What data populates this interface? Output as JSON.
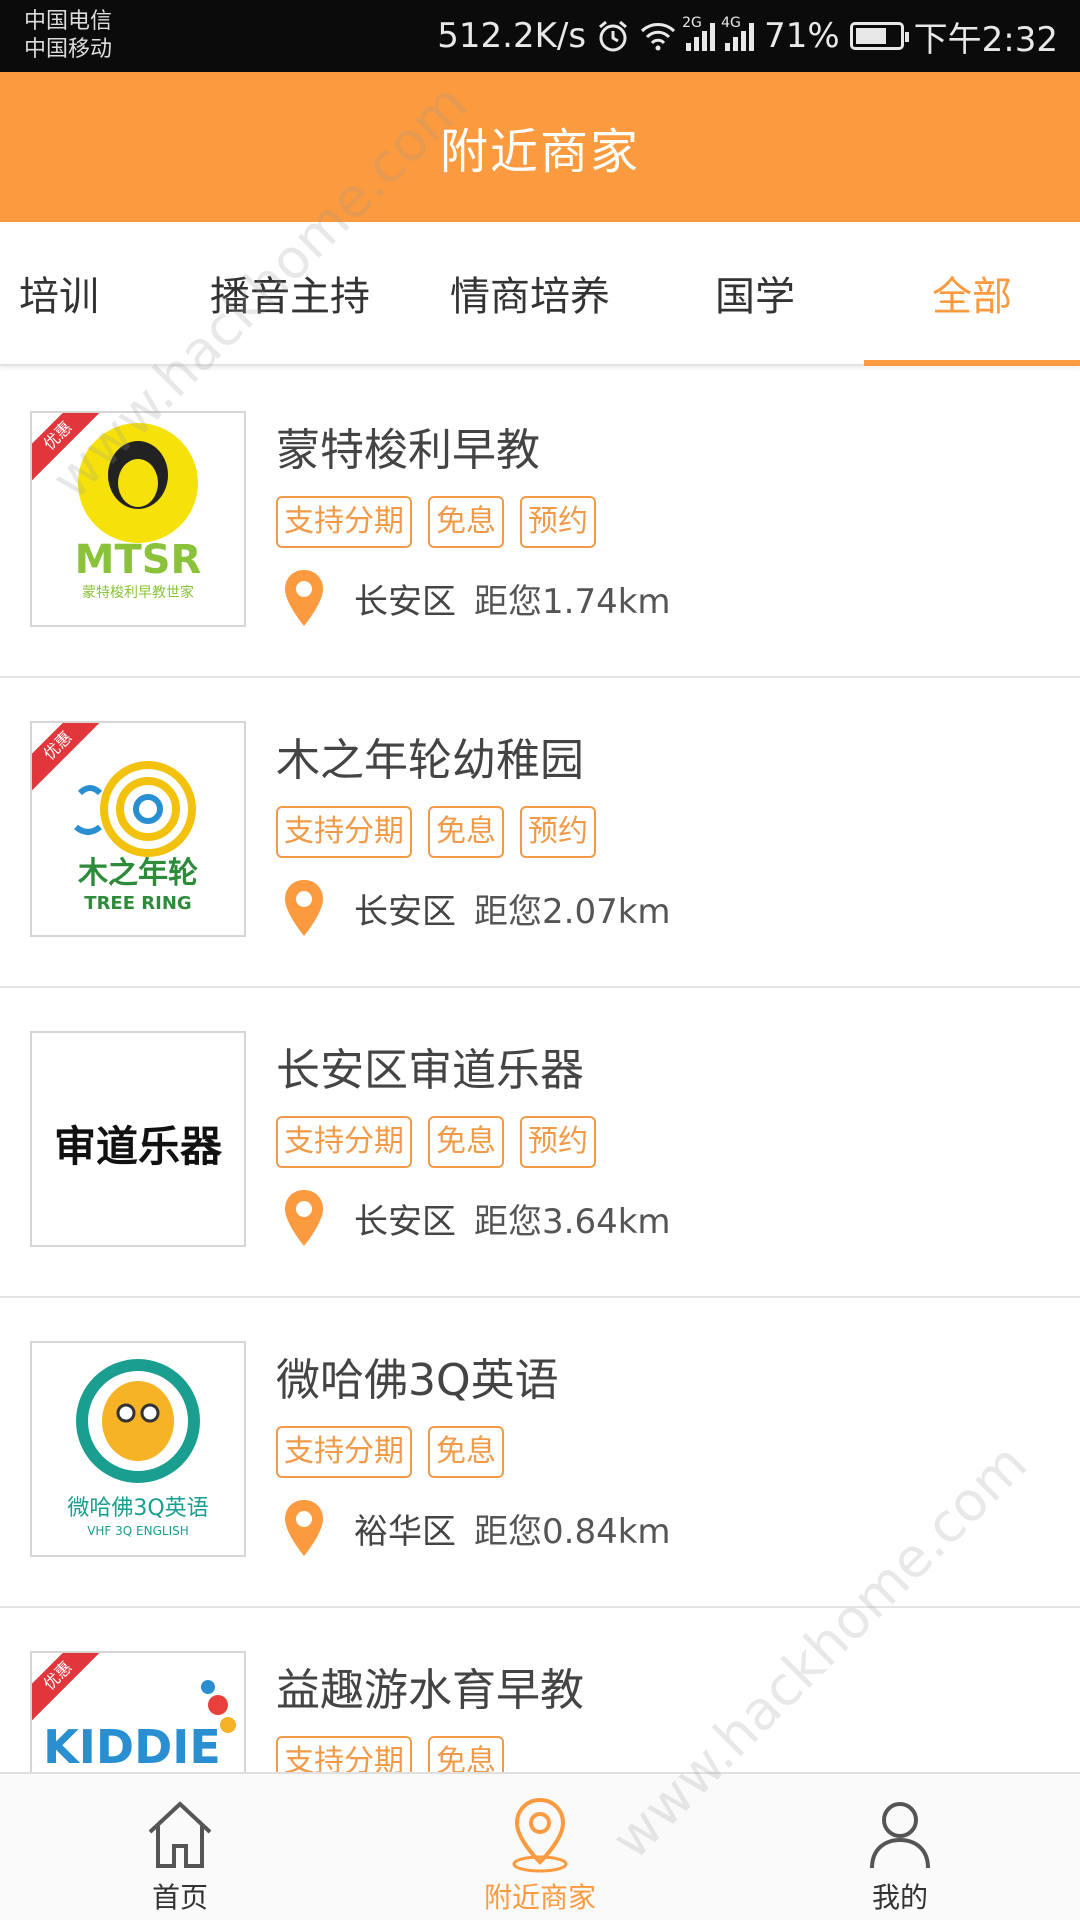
{
  "status_bar": {
    "carrier_1": "中国电信",
    "carrier_2": "中国移动",
    "speed": "512.2K/s",
    "net_2g": "2G",
    "net_4g": "4G",
    "battery": "71%",
    "battery_level": 0.71,
    "time": "下午2:32"
  },
  "header": {
    "title": "附近商家"
  },
  "tabs": [
    {
      "label": "培训",
      "active": false
    },
    {
      "label": "播音主持",
      "active": false
    },
    {
      "label": "情商培养",
      "active": false
    },
    {
      "label": "国学",
      "active": false
    },
    {
      "label": "全部",
      "active": true
    }
  ],
  "merchants": [
    {
      "name": "蒙特梭利早教",
      "badge": "优惠",
      "tags": [
        "支持分期",
        "免息",
        "预约"
      ],
      "district": "长安区",
      "distance": "距您1.74km",
      "logo_text": "MTSR",
      "logo_sub": "蒙特梭利早教世家"
    },
    {
      "name": "木之年轮幼稚园",
      "badge": "优惠",
      "tags": [
        "支持分期",
        "免息",
        "预约"
      ],
      "district": "长安区",
      "distance": "距您2.07km",
      "logo_text": "木之年轮",
      "logo_sub": "TREE RING"
    },
    {
      "name": "长安区审道乐器",
      "badge": "",
      "tags": [
        "支持分期",
        "免息",
        "预约"
      ],
      "district": "长安区",
      "distance": "距您3.64km",
      "logo_text": "审道乐器"
    },
    {
      "name": "微哈佛3Q英语",
      "badge": "",
      "tags": [
        "支持分期",
        "免息"
      ],
      "district": "裕华区",
      "distance": "距您0.84km",
      "logo_text": "微哈佛3Q英语",
      "logo_sub": "VHF 3Q ENGLISH"
    },
    {
      "name": "益趣游水育早教",
      "badge": "优惠",
      "tags": [
        "支持分期",
        "免息"
      ],
      "district": "",
      "distance": "",
      "logo_text": "KIDDIE"
    }
  ],
  "bottom_nav": [
    {
      "label": "首页",
      "icon": "home-icon",
      "active": false
    },
    {
      "label": "附近商家",
      "icon": "location-icon",
      "active": true
    },
    {
      "label": "我的",
      "icon": "profile-icon",
      "active": false
    }
  ],
  "colors": {
    "accent": "#fb9a3e",
    "tag": "#f19a48",
    "badge": "#e0363c"
  },
  "watermark": "www.hackhome.com"
}
